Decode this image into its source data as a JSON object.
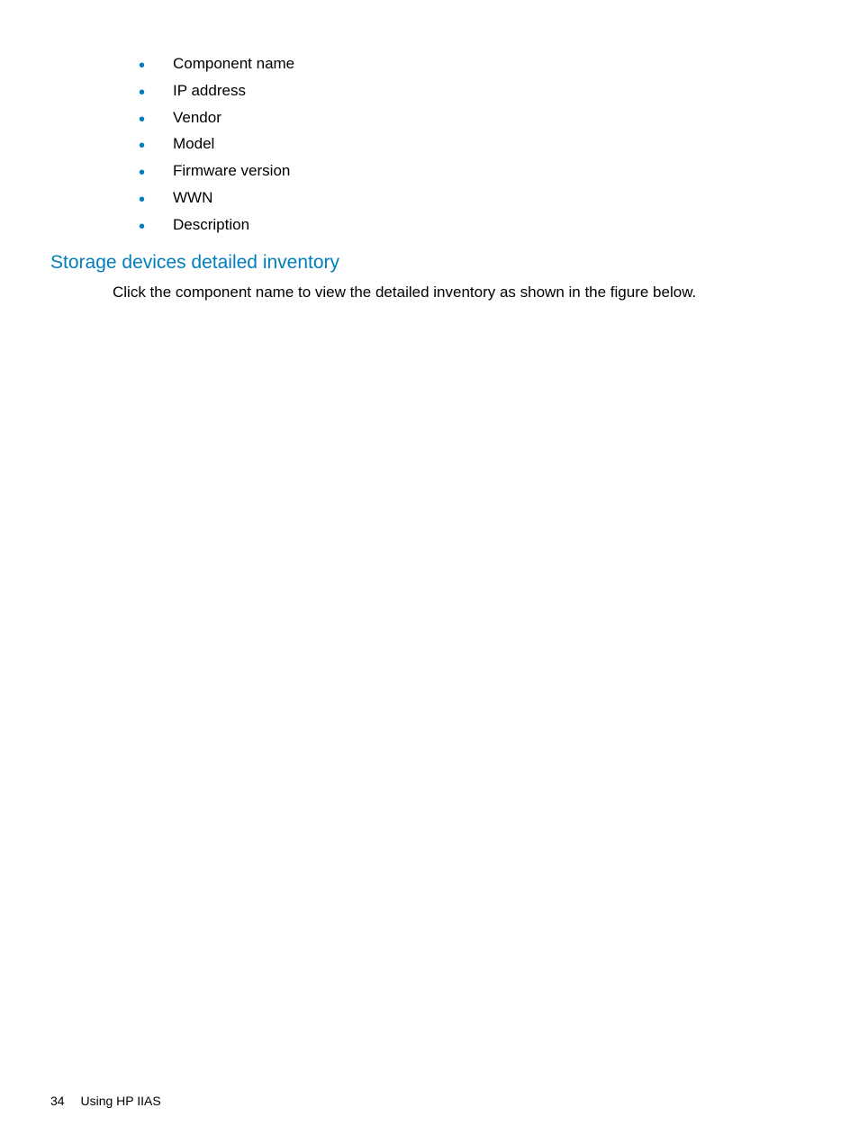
{
  "bullets": {
    "items": [
      "Component name",
      "IP address",
      "Vendor",
      "Model",
      "Firmware version",
      "WWN",
      "Description"
    ]
  },
  "section": {
    "heading": "Storage devices detailed inventory",
    "body": "Click the component name to view the detailed inventory as shown in the figure below."
  },
  "footer": {
    "page_number": "34",
    "section_title": "Using HP IIAS"
  }
}
